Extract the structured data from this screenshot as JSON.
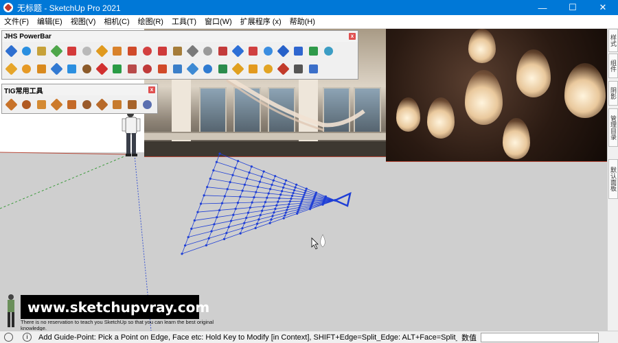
{
  "window": {
    "title": "无标题 - SketchUp Pro 2021",
    "minimize_label": "—",
    "maximize_label": "☐",
    "close_label": "✕"
  },
  "menu": {
    "items": [
      {
        "label": "文件(F)"
      },
      {
        "label": "编辑(E)"
      },
      {
        "label": "视图(V)"
      },
      {
        "label": "相机(C)"
      },
      {
        "label": "绘图(R)"
      },
      {
        "label": "工具(T)"
      },
      {
        "label": "窗口(W)"
      },
      {
        "label": "扩展程序 (x)"
      },
      {
        "label": "帮助(H)"
      }
    ]
  },
  "toolbars": {
    "jhs": {
      "title": "JHS PowerBar",
      "row1": [
        "#2e6fd0",
        "#2a8fe0",
        "#c7a23a",
        "#4ea64a",
        "#d43a3a",
        "#b9b9b9",
        "#e09a1e",
        "#d9822b",
        "#d04a2a",
        "#d34040",
        "#cf3b3b",
        "#a67d3a",
        "#7a7a7a",
        "#9a9a9a",
        "#c33b3b",
        "#2d6fd6",
        "#d04040",
        "#3b8de0",
        "#2761c9",
        "#2f66cf",
        "#2f9a4a",
        "#3c9dc4"
      ],
      "row2": [
        "#e6a52a",
        "#e69a26",
        "#d98a1e",
        "#3179d2",
        "#2b8fe0",
        "#8b5a2a",
        "#d13030",
        "#2a9b45",
        "#b84a4a",
        "#c03a3a",
        "#d14a2a",
        "#3b7fc9",
        "#3d8ad4",
        "#2f7bd1",
        "#2b8c4d",
        "#e0a020",
        "#e39a1f",
        "#e2a424",
        "#c23a2a",
        "#555555",
        "#3b6fc9"
      ]
    },
    "tig": {
      "title": "TIG常用工具",
      "row1": [
        "#c8732a",
        "#b05a22",
        "#d48a32",
        "#cc7a2a",
        "#c46a28",
        "#9a5a2a",
        "#b86a2a",
        "#c77b2e",
        "#a6632a",
        "#5a6fb0"
      ]
    },
    "close_label": "x"
  },
  "right_panel": {
    "tabs": [
      {
        "label": "样式"
      },
      {
        "label": "组件"
      },
      {
        "label": "阴影"
      },
      {
        "label": "管理目录"
      },
      {
        "label": "默认面板"
      }
    ]
  },
  "watermark": {
    "site": "www.sketchupvray.com",
    "note": "There is no reservation to teach you SketchUp so that you can learn the best original knowledge."
  },
  "status_bar": {
    "info_icon": "i",
    "message": "Add Guide-Point: Pick a Point on Edge, Face etc: Hold Key to Modify [in Context], SHIFT+Edge=Split_Edge: ALT+Face=Split_...",
    "value_label": "数值",
    "value": ""
  },
  "colors": {
    "titlebar": "#0078d7",
    "viewport_ground": "#cfcfcf",
    "mesh": "#1f3fd6",
    "axis_red": "#b94a3a",
    "axis_green": "#3a9a3a",
    "axis_blue": "#3a55d0"
  }
}
